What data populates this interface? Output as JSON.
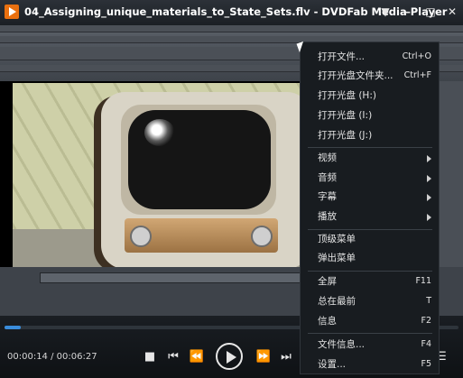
{
  "window": {
    "title": "04_Assigning_unique_materials_to_State_Sets.flv - DVDFab Media Player",
    "controls": [
      "▼",
      "–",
      "□",
      "✕"
    ]
  },
  "player": {
    "time": "00:00:14 / 00:06:27",
    "progress": 0.036
  },
  "menu": {
    "items": [
      {
        "label": "打开文件...",
        "shortcut": "Ctrl+O"
      },
      {
        "label": "打开光盘文件夹...",
        "shortcut": "Ctrl+F"
      },
      {
        "label": "打开光盘 (H:)",
        "shortcut": ""
      },
      {
        "label": "打开光盘 (I:)",
        "shortcut": ""
      },
      {
        "label": "打开光盘 (J:)",
        "shortcut": ""
      },
      {
        "label": "视频",
        "shortcut": ""
      },
      {
        "label": "音频",
        "shortcut": ""
      },
      {
        "label": "字幕",
        "shortcut": ""
      },
      {
        "label": "播放",
        "shortcut": ""
      },
      {
        "label": "顶级菜单",
        "shortcut": ""
      },
      {
        "label": "弹出菜单",
        "shortcut": ""
      },
      {
        "label": "全屏",
        "shortcut": "F11"
      },
      {
        "label": "总在最前",
        "shortcut": "T"
      },
      {
        "label": "信息",
        "shortcut": "F2"
      },
      {
        "label": "文件信息...",
        "shortcut": "F4"
      },
      {
        "label": "设置...",
        "shortcut": "F5"
      }
    ]
  }
}
